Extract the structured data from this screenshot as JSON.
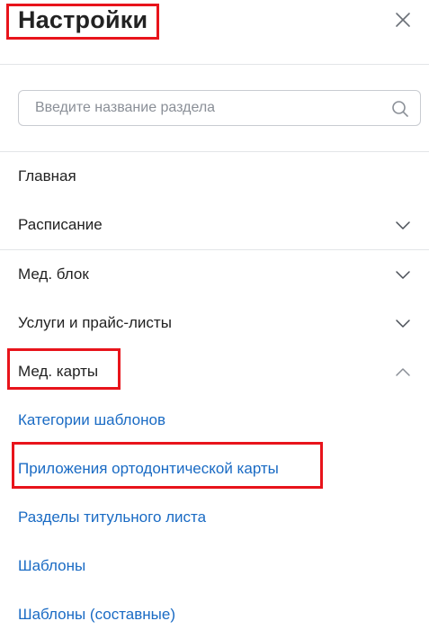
{
  "header": {
    "title": "Настройки",
    "close_icon": "close-icon"
  },
  "search": {
    "placeholder": "Введите название раздела",
    "value": "",
    "icon": "search-icon"
  },
  "menu": {
    "items": [
      {
        "label": "Главная",
        "expandable": false
      },
      {
        "label": "Расписание",
        "expandable": true,
        "expanded": false,
        "icon": "chevron-down-icon"
      },
      {
        "label": "Мед. блок",
        "expandable": true,
        "expanded": false,
        "icon": "chevron-down-icon"
      },
      {
        "label": "Услуги и прайс-листы",
        "expandable": true,
        "expanded": false,
        "icon": "chevron-down-icon"
      },
      {
        "label": "Мед. карты",
        "expandable": true,
        "expanded": true,
        "icon": "chevron-up-icon"
      }
    ],
    "med_cards_children": [
      {
        "label": "Категории шаблонов"
      },
      {
        "label": "Приложения ортодонтической карты"
      },
      {
        "label": "Разделы титульного листа"
      },
      {
        "label": "Шаблоны"
      },
      {
        "label": "Шаблоны (составные)"
      }
    ]
  },
  "colors": {
    "text": "#222222",
    "link": "#1a6bc4",
    "divider": "#e3e5e8",
    "highlight": "#e8141b"
  }
}
